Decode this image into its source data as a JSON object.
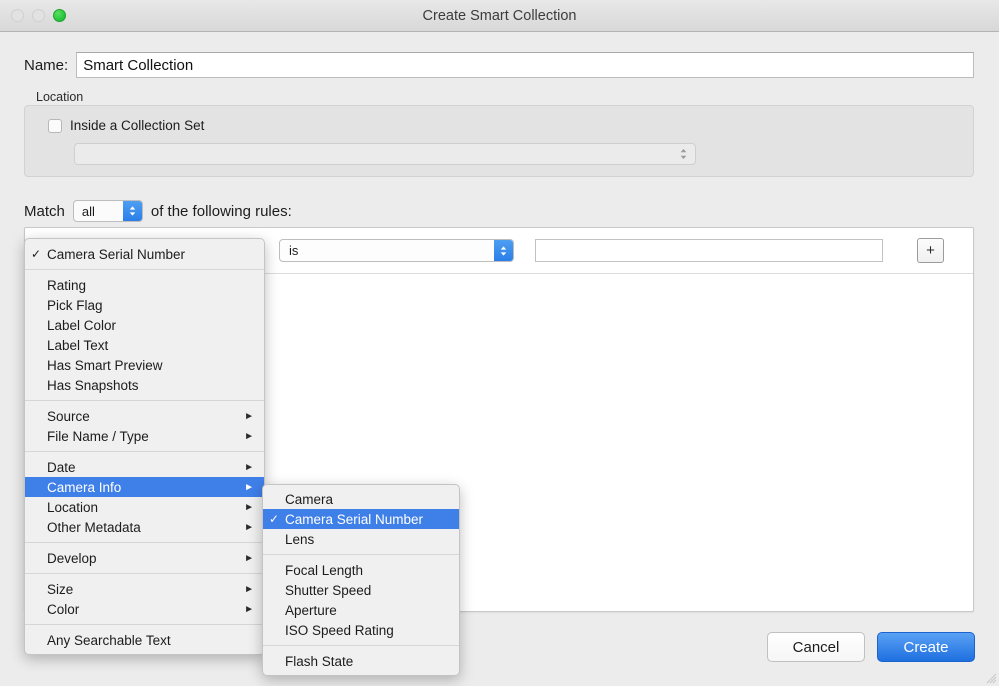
{
  "window": {
    "title": "Create Smart Collection",
    "traffic_lights": [
      {
        "name": "close",
        "state": "disabled"
      },
      {
        "name": "minimize",
        "state": "disabled"
      },
      {
        "name": "zoom",
        "state": "green"
      }
    ],
    "accent_blue": "#3f7fe8",
    "default_button_blue": "#1e6fe0"
  },
  "name_field": {
    "label": "Name:",
    "value": "Smart Collection",
    "placeholder": ""
  },
  "location": {
    "group_label": "Location",
    "checkbox_label": "Inside a Collection Set",
    "checkbox_checked": false,
    "collection_set_value": "",
    "collection_set_enabled": false
  },
  "match": {
    "prefix": "Match",
    "operator": "all",
    "suffix": "of the following rules:"
  },
  "rule": {
    "criterion": "Camera Serial Number",
    "operator": "is",
    "value": "",
    "add_button_label": "+"
  },
  "footer": {
    "cancel_label": "Cancel",
    "create_label": "Create"
  },
  "menu_main": {
    "groups": [
      {
        "items": [
          {
            "label": "Camera Serial Number",
            "checked": true,
            "submenu": false,
            "selected": false
          }
        ]
      },
      {
        "items": [
          {
            "label": "Rating",
            "checked": false,
            "submenu": false,
            "selected": false
          },
          {
            "label": "Pick Flag",
            "checked": false,
            "submenu": false,
            "selected": false
          },
          {
            "label": "Label Color",
            "checked": false,
            "submenu": false,
            "selected": false
          },
          {
            "label": "Label Text",
            "checked": false,
            "submenu": false,
            "selected": false
          },
          {
            "label": "Has Smart Preview",
            "checked": false,
            "submenu": false,
            "selected": false
          },
          {
            "label": "Has Snapshots",
            "checked": false,
            "submenu": false,
            "selected": false
          }
        ]
      },
      {
        "items": [
          {
            "label": "Source",
            "checked": false,
            "submenu": true,
            "selected": false
          },
          {
            "label": "File Name / Type",
            "checked": false,
            "submenu": true,
            "selected": false
          }
        ]
      },
      {
        "items": [
          {
            "label": "Date",
            "checked": false,
            "submenu": true,
            "selected": false
          },
          {
            "label": "Camera Info",
            "checked": false,
            "submenu": true,
            "selected": true
          },
          {
            "label": "Location",
            "checked": false,
            "submenu": true,
            "selected": false
          },
          {
            "label": "Other Metadata",
            "checked": false,
            "submenu": true,
            "selected": false
          }
        ]
      },
      {
        "items": [
          {
            "label": "Develop",
            "checked": false,
            "submenu": true,
            "selected": false
          }
        ]
      },
      {
        "items": [
          {
            "label": "Size",
            "checked": false,
            "submenu": true,
            "selected": false
          },
          {
            "label": "Color",
            "checked": false,
            "submenu": true,
            "selected": false
          }
        ]
      },
      {
        "items": [
          {
            "label": "Any Searchable Text",
            "checked": false,
            "submenu": false,
            "selected": false
          }
        ]
      }
    ]
  },
  "menu_sub": {
    "parent": "Camera Info",
    "groups": [
      {
        "items": [
          {
            "label": "Camera",
            "checked": false,
            "selected": false
          },
          {
            "label": "Camera Serial Number",
            "checked": true,
            "selected": true
          },
          {
            "label": "Lens",
            "checked": false,
            "selected": false
          }
        ]
      },
      {
        "items": [
          {
            "label": "Focal Length",
            "checked": false,
            "selected": false
          },
          {
            "label": "Shutter Speed",
            "checked": false,
            "selected": false
          },
          {
            "label": "Aperture",
            "checked": false,
            "selected": false
          },
          {
            "label": "ISO Speed Rating",
            "checked": false,
            "selected": false
          }
        ]
      },
      {
        "items": [
          {
            "label": "Flash State",
            "checked": false,
            "selected": false
          }
        ]
      }
    ]
  },
  "glyphs": {
    "checkmark": "✓",
    "submenu_arrow": "►",
    "stepper": "⌃⌄"
  }
}
